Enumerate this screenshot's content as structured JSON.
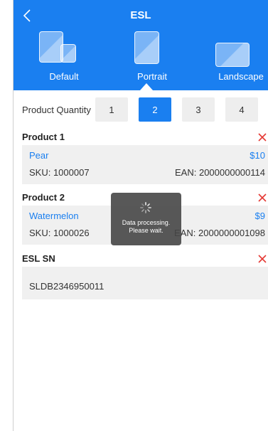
{
  "header": {
    "title": "ESL",
    "layouts": [
      {
        "label": "Default"
      },
      {
        "label": "Portrait"
      },
      {
        "label": "Landscape"
      }
    ],
    "selected_layout": "Portrait"
  },
  "quantity": {
    "label": "Product Quantity",
    "options": [
      "1",
      "2",
      "3",
      "4"
    ],
    "selected": "2"
  },
  "products": [
    {
      "heading": "Product 1",
      "name": "Pear",
      "price": "$10",
      "sku": "SKU: 1000007",
      "ean": "EAN: 2000000000114"
    },
    {
      "heading": "Product 2",
      "name": "Watermelon",
      "price": "$9",
      "sku": "SKU: 1000026",
      "ean": "EAN: 2000000001098"
    }
  ],
  "esl": {
    "heading": "ESL SN",
    "value": "SLDB2346950011"
  },
  "toast": {
    "line1": "Data processing.",
    "line2": "Please wait."
  },
  "colors": {
    "accent": "#1a7ff0",
    "delete": "#e53935",
    "card_bg": "#f0f0f0"
  },
  "icons": {
    "back": "chevron-left-icon",
    "delete": "close-icon",
    "loading": "spinner-icon"
  }
}
